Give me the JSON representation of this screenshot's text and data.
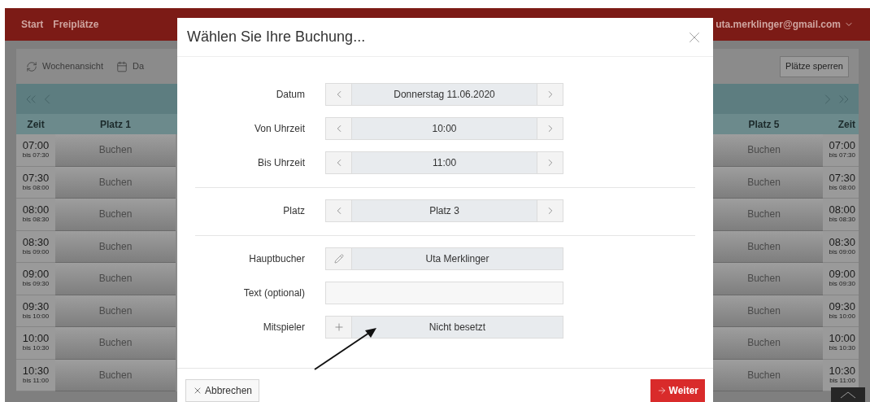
{
  "top_nav": {
    "links": [
      "Start",
      "Freiplätze"
    ],
    "user": "uta.merklinger@gmail.com"
  },
  "toolbar": {
    "items": [
      {
        "label": "Wochenansicht",
        "kind": "refresh"
      },
      {
        "label": "Da",
        "kind": "calendar"
      }
    ],
    "lock_button": "Plätze sperren"
  },
  "schedule": {
    "left_columns": [
      "Zeit",
      "Platz 1"
    ],
    "right_columns": [
      "Platz 5",
      "Zeit"
    ],
    "rows": [
      {
        "time": "07:00",
        "until": "bis 07:30",
        "left_cell": "Buchen",
        "right_cell": "Buchen",
        "right_time": "07:00",
        "right_until": "bis 07:30"
      },
      {
        "time": "07:30",
        "until": "bis 08:00",
        "left_cell": "Buchen",
        "right_cell": "Buchen",
        "right_time": "07:30",
        "right_until": "bis 08:00"
      },
      {
        "time": "08:00",
        "until": "bis 08:30",
        "left_cell": "Buchen",
        "right_cell": "Buchen",
        "right_time": "08:00",
        "right_until": "bis 08:30"
      },
      {
        "time": "08:30",
        "until": "bis 09:00",
        "left_cell": "Buchen",
        "right_cell": "Buchen",
        "right_time": "08:30",
        "right_until": "bis 09:00"
      },
      {
        "time": "09:00",
        "until": "bis 09:30",
        "left_cell": "Buchen",
        "right_cell": "Buchen",
        "right_time": "09:00",
        "right_until": "bis 09:30"
      },
      {
        "time": "09:30",
        "until": "bis 10:00",
        "left_cell": "Buchen",
        "right_cell": "Buchen",
        "right_time": "09:30",
        "right_until": "bis 10:00"
      },
      {
        "time": "10:00",
        "until": "bis 10:30",
        "left_cell": "Buchen",
        "right_cell": "Buchen",
        "right_time": "10:00",
        "right_until": "bis 10:30"
      },
      {
        "time": "10:30",
        "until": "bis 11:00",
        "left_cell": "Buchen",
        "right_cell": "Buchen",
        "right_time": "10:30",
        "right_until": "bis 11:00"
      }
    ]
  },
  "dialog": {
    "title": "Wählen Sie Ihre Buchung...",
    "groups": [
      [
        {
          "label": "Datum",
          "kind": "stepper",
          "value": "Donnerstag 11.06.2020"
        },
        {
          "label": "Von Uhrzeit",
          "kind": "stepper",
          "value": "10:00"
        },
        {
          "label": "Bis Uhrzeit",
          "kind": "stepper",
          "value": "11:00"
        }
      ],
      [
        {
          "label": "Platz",
          "kind": "stepper",
          "value": "Platz 3"
        }
      ],
      [
        {
          "label": "Hauptbucher",
          "kind": "edit",
          "value": "Uta Merklinger"
        },
        {
          "label": "Text (optional)",
          "kind": "text"
        },
        {
          "label": "Mitspieler",
          "kind": "add",
          "value": "Nicht besetzt"
        }
      ]
    ],
    "cancel_button": "Abbrechen",
    "next_button": "Weiter"
  }
}
